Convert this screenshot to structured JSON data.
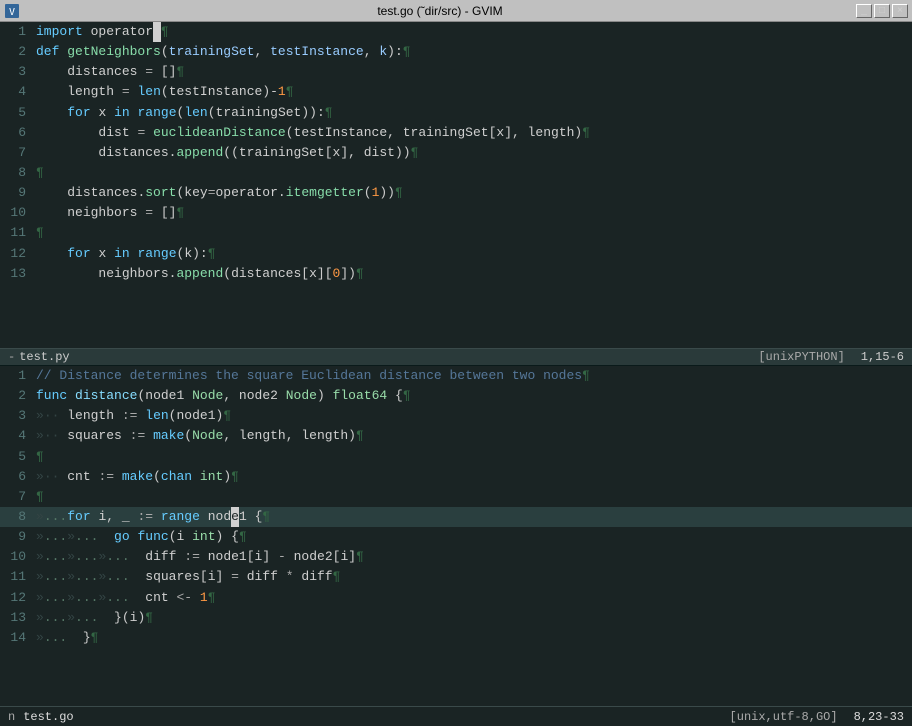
{
  "window": {
    "title": "test.go (˜dir/src) - GVIM",
    "titlebar_icon": "♥"
  },
  "titlebar_buttons": [
    "_",
    "□",
    "×"
  ],
  "top_pane": {
    "lines": [
      {
        "num": 1,
        "content": "import operator",
        "eol": true
      },
      {
        "num": 2,
        "content": "def getNeighbors(trainingSet, testInstance, k):",
        "eol": true
      },
      {
        "num": 3,
        "content": "    distances = []",
        "eol": true
      },
      {
        "num": 4,
        "content": "    length = len(testInstance)-1",
        "eol": true
      },
      {
        "num": 5,
        "content": "    for x in range(len(trainingSet)):",
        "eol": true
      },
      {
        "num": 6,
        "content": "        dist = euclideanDistance(testInstance, trainingSet[x], length)",
        "eol": true
      },
      {
        "num": 7,
        "content": "        distances.append((trainingSet[x], dist))",
        "eol": true
      },
      {
        "num": 8,
        "content": "",
        "eol": true
      },
      {
        "num": 9,
        "content": "    distances.sort(key=operator.itemgetter(1))",
        "eol": true
      },
      {
        "num": 10,
        "content": "    neighbors = []",
        "eol": true
      },
      {
        "num": 11,
        "content": "",
        "eol": true
      },
      {
        "num": 12,
        "content": "    for x in range(k):",
        "eol": true
      },
      {
        "num": 13,
        "content": "        neighbors.append(distances[x][0])",
        "eol": true
      }
    ]
  },
  "divider": {
    "minus": "-",
    "filename": "test.py",
    "fileinfo": "[unixPYTHON]",
    "position": "1,15-6"
  },
  "bottom_pane": {
    "lines": [
      {
        "num": 1,
        "content": "// Distance determines the square Euclidean distance between two nodes",
        "eol": true
      },
      {
        "num": 2,
        "content": "func distance(node1 Node, node2 Node) float64 {",
        "eol": true
      },
      {
        "num": 3,
        "content": "»  length := len(node1)",
        "eol": true
      },
      {
        "num": 4,
        "content": "»  squares := make(Node, length, length)",
        "eol": true
      },
      {
        "num": 5,
        "content": "",
        "eol": true
      },
      {
        "num": 6,
        "content": "»  cnt := make(chan int)",
        "eol": true
      },
      {
        "num": 7,
        "content": "",
        "eol": true
      },
      {
        "num": 8,
        "content": "»...for i, _ := range node1 {",
        "eol": true,
        "highlighted": true
      },
      {
        "num": 9,
        "content": "»...»...  go func(i int) {",
        "eol": true
      },
      {
        "num": 10,
        "content": "»...»...»...  diff := node1[i] - node2[i]",
        "eol": true
      },
      {
        "num": 11,
        "content": "»...»...»...  squares[i] = diff * diff",
        "eol": true
      },
      {
        "num": 12,
        "content": "»...»...»...  cnt <- 1",
        "eol": true
      },
      {
        "num": 13,
        "content": "»...»...  }(i)",
        "eol": true
      },
      {
        "num": 14,
        "content": "»...  }",
        "eol": true
      }
    ]
  },
  "statusbar": {
    "buf_indicator": "n",
    "filename": "test.go",
    "fileinfo": "[unix,utf-8,GO]",
    "position": "8,23-33"
  }
}
